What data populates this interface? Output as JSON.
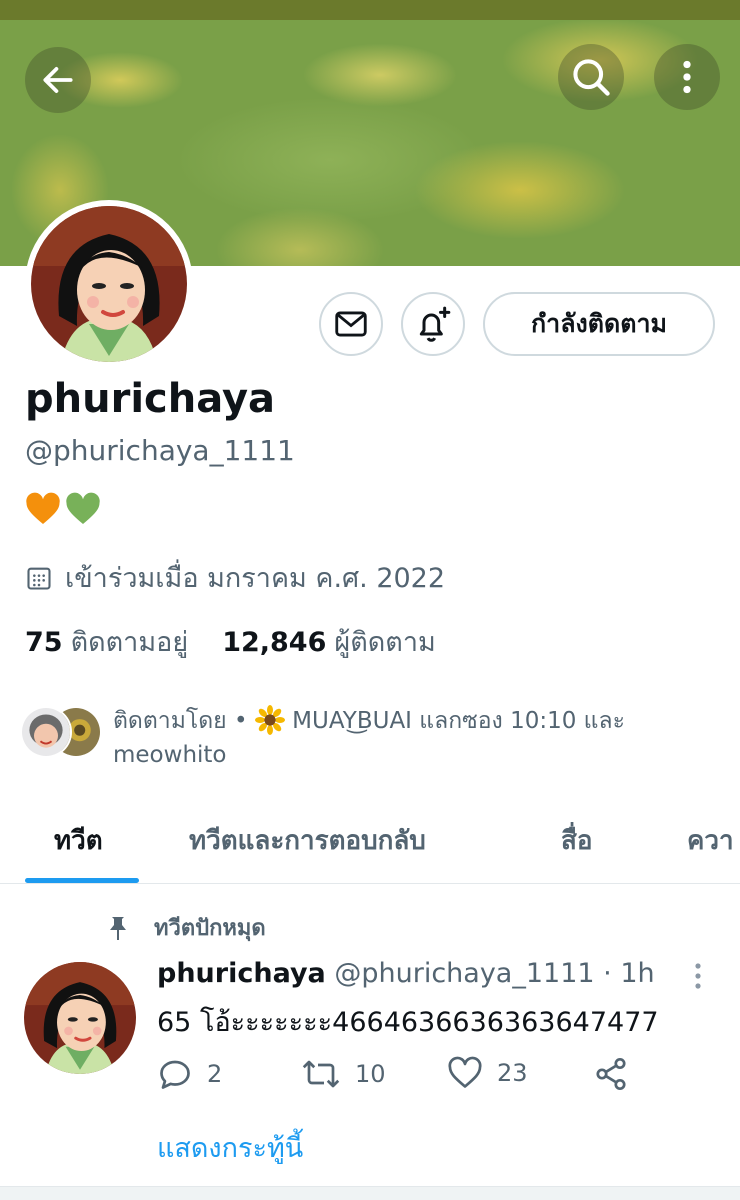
{
  "header": {
    "back_icon": "arrow-left-icon",
    "search_icon": "search-icon",
    "more_icon": "more-vertical-icon"
  },
  "profile": {
    "display_name": "phurichaya",
    "handle": "@phurichaya_1111",
    "bio_hearts": [
      "orange-heart",
      "green-heart"
    ],
    "joined": "เข้าร่วมเมื่อ มกราคม ค.ศ. 2022",
    "following_count": "75",
    "following_label": "ติดตามอยู่",
    "followers_count": "12,846",
    "followers_label": "ผู้ติดตาม",
    "followed_by_prefix": "ติดตามโดย • ",
    "followed_by_rest": " MUAY͜BUAI แลกซอง 10:10 และ meowhito"
  },
  "actions": {
    "following_button": "กำลังติดตาม",
    "message_icon": "mail-icon",
    "notify_icon": "bell-plus-icon"
  },
  "tabs": [
    {
      "label": "ทวีต",
      "active": true
    },
    {
      "label": "ทวีตและการตอบกลับ",
      "active": false
    },
    {
      "label": "สื่อ",
      "active": false
    },
    {
      "label": "ควา",
      "active": false
    }
  ],
  "pinned_tweet": {
    "pinned_label": "ทวีตปักหมุด",
    "name": "phurichaya",
    "meta": " @phurichaya_1111 · 1h",
    "text": "65 โอ้ะะะะะะะ4664636636363647477",
    "replies": "2",
    "retweets": "10",
    "likes": "23",
    "show_thread": "แสดงกระทู้นี้"
  },
  "colors": {
    "accent": "#1d9bf0",
    "secondary_text": "#536471",
    "heart_orange": "#f4900c",
    "heart_green": "#78b159"
  }
}
